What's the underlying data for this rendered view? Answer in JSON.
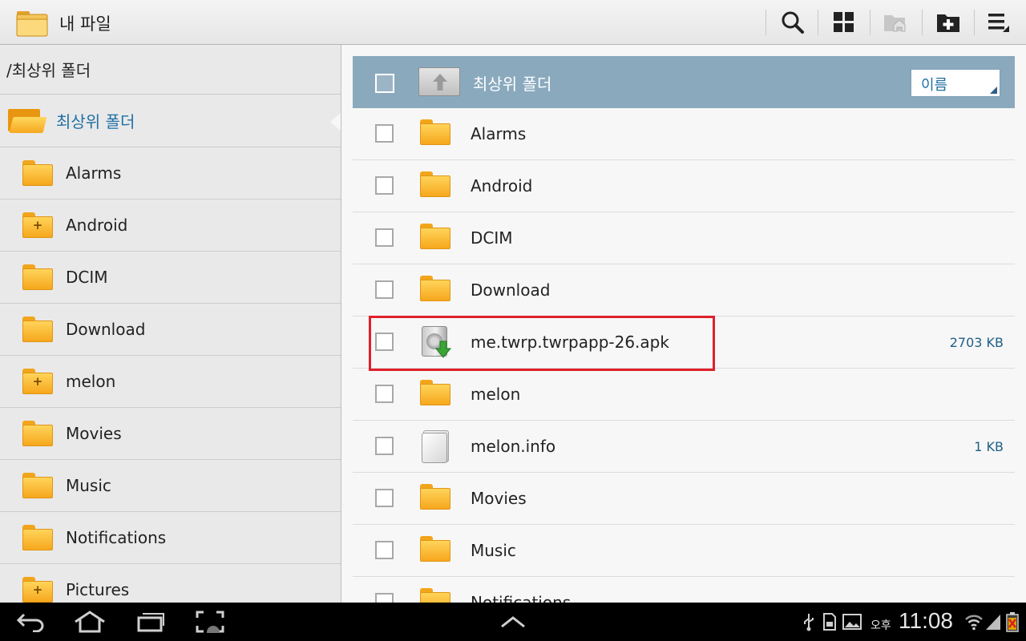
{
  "app": {
    "title": "내 파일",
    "icon": "folder-icon",
    "actions": [
      {
        "name": "search",
        "icon": "search-icon"
      },
      {
        "name": "view-mode",
        "icon": "grid-icon"
      },
      {
        "name": "set-home",
        "icon": "folder-home-icon",
        "enabled": false
      },
      {
        "name": "new-folder",
        "icon": "folder-add-icon"
      },
      {
        "name": "menu",
        "icon": "overflow-menu-icon"
      }
    ]
  },
  "sidebar": {
    "path": "/최상위 폴더",
    "root_label": "최상위 폴더",
    "items": [
      {
        "label": "Alarms",
        "has_children": false
      },
      {
        "label": "Android",
        "has_children": true
      },
      {
        "label": "DCIM",
        "has_children": false
      },
      {
        "label": "Download",
        "has_children": false
      },
      {
        "label": "melon",
        "has_children": true
      },
      {
        "label": "Movies",
        "has_children": false
      },
      {
        "label": "Music",
        "has_children": false
      },
      {
        "label": "Notifications",
        "has_children": false
      },
      {
        "label": "Pictures",
        "has_children": true
      }
    ]
  },
  "list": {
    "header_title": "최상위 폴더",
    "sort_label": "이름",
    "rows": [
      {
        "name": "Alarms",
        "type": "folder",
        "size": ""
      },
      {
        "name": "Android",
        "type": "folder",
        "size": ""
      },
      {
        "name": "DCIM",
        "type": "folder",
        "size": ""
      },
      {
        "name": "Download",
        "type": "folder",
        "size": ""
      },
      {
        "name": "me.twrp.twrpapp-26.apk",
        "type": "apk",
        "size": "2703 KB"
      },
      {
        "name": "melon",
        "type": "folder",
        "size": ""
      },
      {
        "name": "melon.info",
        "type": "file",
        "size": "1 KB"
      },
      {
        "name": "Movies",
        "type": "folder",
        "size": ""
      },
      {
        "name": "Music",
        "type": "folder",
        "size": ""
      },
      {
        "name": "Notifications",
        "type": "folder",
        "size": ""
      }
    ],
    "highlighted_row": 4,
    "highlight_color": "#e0202a"
  },
  "status": {
    "ampm": "오후",
    "time": "11:08"
  },
  "colors": {
    "accent": "#1f6fa5",
    "header_bg": "#8aa9bd",
    "folder": "#f6a71d"
  }
}
